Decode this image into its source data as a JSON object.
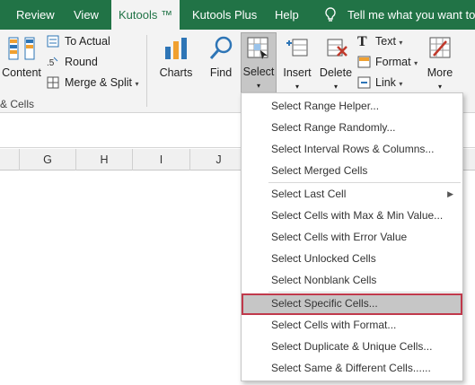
{
  "tabs": {
    "review": "Review",
    "view": "View",
    "kutools": "Kutools ™",
    "kutools_plus": "Kutools Plus",
    "help": "Help",
    "tell_me": "Tell me what you want to d"
  },
  "ribbon": {
    "content_label": "Content",
    "cells_group_label": "& Cells",
    "to_actual": "To Actual",
    "round": "Round",
    "merge_split": "Merge & Split",
    "charts": "Charts",
    "find": "Find",
    "select": "Select",
    "insert": "Insert",
    "delete": "Delete",
    "text": "Text",
    "format": "Format",
    "link": "Link",
    "more": "More"
  },
  "columns": [
    "G",
    "H",
    "I",
    "J"
  ],
  "menu": {
    "items": [
      "Select Range Helper...",
      "Select Range Randomly...",
      "Select Interval Rows & Columns...",
      "Select Merged Cells",
      "Select Last Cell",
      "Select Cells with Max & Min Value...",
      "Select Cells with Error Value",
      "Select Unlocked Cells",
      "Select Nonblank Cells",
      "Select Specific Cells...",
      "Select Cells with Format...",
      "Select Duplicate & Unique Cells...",
      "Select Same & Different Cells......"
    ],
    "highlighted": "Select Specific Cells..."
  },
  "colors": {
    "ribbon_tab_bg": "#217346",
    "highlight_border": "#c0394b",
    "menu_highlight_bg": "#c6c6c6"
  }
}
